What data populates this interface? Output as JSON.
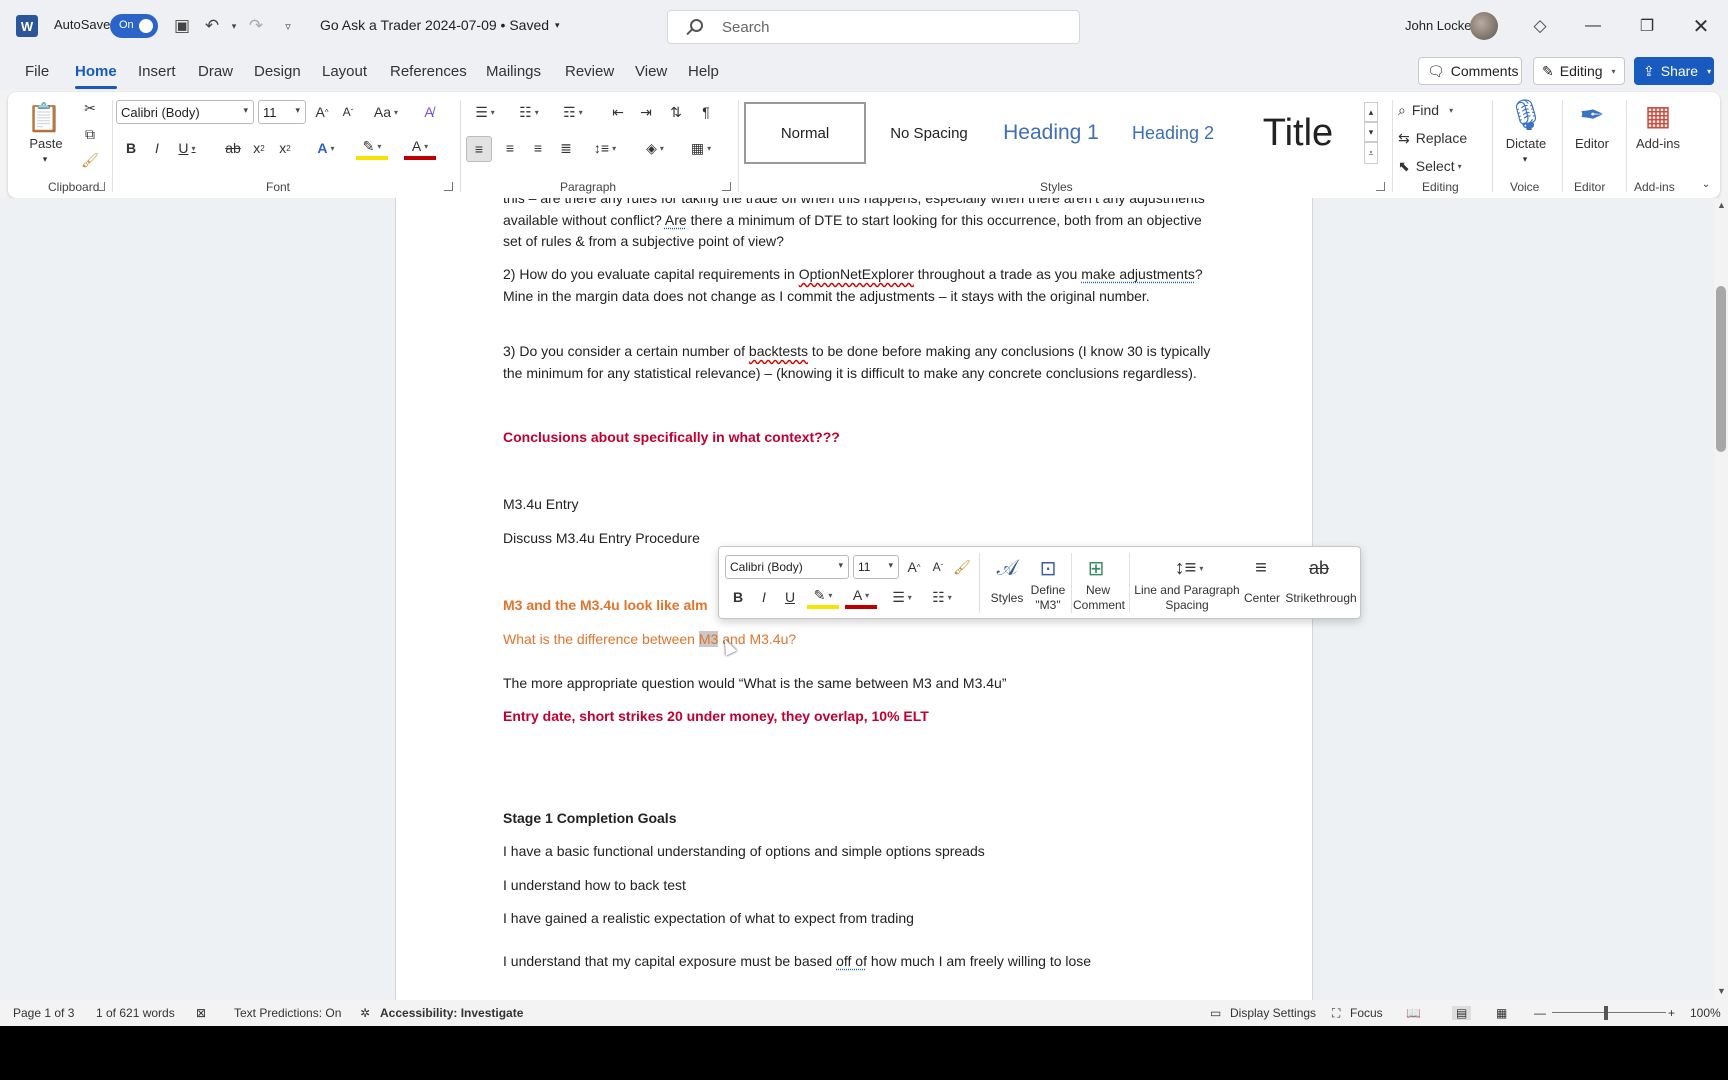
{
  "titlebar": {
    "app_logo": "W",
    "autosave_label": "AutoSave",
    "autosave_state": "On",
    "doc_title": "Go Ask a Trader 2024-07-09 • Saved",
    "search_placeholder": "Search",
    "user_name": "John Locke"
  },
  "menu": {
    "tabs": [
      "File",
      "Home",
      "Insert",
      "Draw",
      "Design",
      "Layout",
      "References",
      "Mailings",
      "Review",
      "View",
      "Help"
    ],
    "comments": "Comments",
    "editing": "Editing",
    "share": "Share"
  },
  "ribbon": {
    "paste": "Paste",
    "font_name": "Calibri (Body)",
    "font_size": "11",
    "styles": [
      "Normal",
      "No Spacing",
      "Heading 1",
      "Heading 2",
      "Title"
    ],
    "find": "Find",
    "replace": "Replace",
    "select": "Select",
    "dictate": "Dictate",
    "editor": "Editor",
    "addins": "Add-ins",
    "groups": [
      "Clipboard",
      "Font",
      "Paragraph",
      "Styles",
      "Editing",
      "Voice",
      "Editor",
      "Add-ins"
    ]
  },
  "document": {
    "p1": "this – are there any rules for taking the trade off when this happens, especially when there aren’t any adjustments available without conflict?",
    "p1_are": "Are",
    "p1_rest": " there a minimum of DTE to start looking for this occurrence, both from an objective set of rules & from a subjective point of view?",
    "p2_a": "2) How do you evaluate capital requirements in ",
    "p2_one": "OptionNetExplorer",
    "p2_b": " throughout a trade as you ",
    "p2_make": "make adjustments",
    "p2_c": "? Mine in the margin data does not change as I commit the adjustments – it stays with the original number.",
    "p3_a": "3) Do you consider a certain number of ",
    "p3_bt": "backtests",
    "p3_b": " to be done before making any conclusions (I know 30 is typically the minimum for any statistical relevance) – (knowing it is difficult to make any concrete conclusions regardless).",
    "p4": "Conclusions about specifically in what context???",
    "p5": "M3.4u Entry",
    "p6": "Discuss M3.4u Entry Procedure",
    "p7": "M3 and the M3.4u look like alm",
    "p8_a": "What is the difference between ",
    "p8_sel": "M3",
    "p8_b": " and M3.4u?",
    "p9": "The more appropriate question would “What is the same between M3 and M3.4u”",
    "p10": "Entry date, short strikes 20 under money, they overlap, 10% ELT",
    "p11": "Stage 1 Completion Goals",
    "p12": "I have a basic functional understanding of options and simple options spreads",
    "p13": "I understand how to back test",
    "p14": "I have gained a realistic expectation of what to expect from trading",
    "p15_a": "I understand that my capital exposure must be based ",
    "p15_off": "off of",
    "p15_b": " how much I am freely willing to lose"
  },
  "minitoolbar": {
    "font_name": "Calibri (Body)",
    "font_size": "11",
    "styles": "Styles",
    "define": "Define \"M3\"",
    "new_comment": "New Comment",
    "line_spacing": "Line and Paragraph Spacing",
    "center": "Center",
    "strikethrough": "Strikethrough"
  },
  "status": {
    "page": "Page 1 of 3",
    "words": "1 of 621 words",
    "predictions": "Text Predictions: On",
    "accessibility": "Accessibility: Investigate",
    "display_settings": "Display Settings",
    "focus": "Focus",
    "zoom": "100%"
  }
}
